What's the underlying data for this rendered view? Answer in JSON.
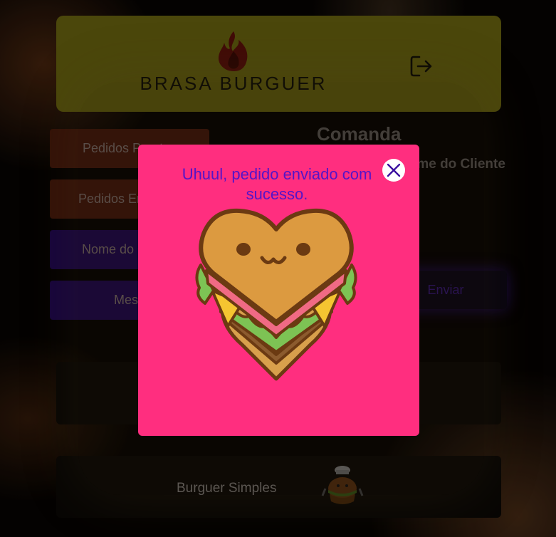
{
  "header": {
    "brand_name": "BRASA BURGUER",
    "logout_icon": "logout-icon"
  },
  "sidebar": {
    "items": [
      {
        "label": "Pedidos Prontos"
      },
      {
        "label": "Pedidos Enviados"
      },
      {
        "label": "Nome do Cliente"
      },
      {
        "label": "Mesa"
      }
    ]
  },
  "comanda": {
    "title": "Comanda",
    "client_label": "Nome do Cliente",
    "send_label": "Enviar"
  },
  "menu": {
    "items": [
      {
        "name": ""
      },
      {
        "name": "Burguer Simples",
        "icon": "chef-burger-icon"
      }
    ]
  },
  "modal": {
    "message": "Uhuul, pedido enviado com sucesso.",
    "close_icon": "close-icon",
    "illustration": "heart-sandwich-icon"
  },
  "colors": {
    "header_bg": "#f0dc2a",
    "modal_bg": "#ff2e7f",
    "modal_text": "#5514c7",
    "button_orange": "#b83c1c",
    "button_purple": "#4a12c4"
  }
}
